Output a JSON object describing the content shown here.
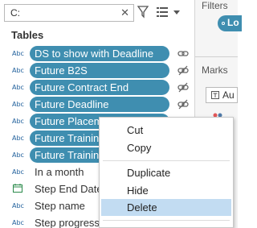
{
  "search": {
    "value": "C:",
    "clear_glyph": "✕"
  },
  "toolbar": {
    "filter_icon": "filter-icon",
    "view_icon": "list-view-icon"
  },
  "tables": {
    "heading": "Tables",
    "fields": [
      {
        "type": "Abc",
        "name": "DS to show with Deadline",
        "selected": true,
        "link_icon": "link-icon"
      },
      {
        "type": "Abc",
        "name": "Future B2S",
        "selected": true,
        "link_icon": "link-broken-icon"
      },
      {
        "type": "Abc",
        "name": "Future Contract End",
        "selected": true,
        "link_icon": "link-broken-icon"
      },
      {
        "type": "Abc",
        "name": "Future Deadline",
        "selected": true,
        "link_icon": "link-broken-icon"
      },
      {
        "type": "Abc",
        "name": "Future Placem",
        "selected": true,
        "link_icon": ""
      },
      {
        "type": "Abc",
        "name": "Future Training",
        "selected": true,
        "link_icon": ""
      },
      {
        "type": "Abc",
        "name": "Future Training",
        "selected": true,
        "link_icon": ""
      },
      {
        "type": "Abc",
        "name": "In a month",
        "selected": false,
        "link_icon": ""
      },
      {
        "type": "date",
        "name": "Step End Date",
        "selected": false,
        "link_icon": ""
      },
      {
        "type": "Abc",
        "name": "Step name",
        "selected": false,
        "link_icon": ""
      },
      {
        "type": "Abc",
        "name": "Step progress",
        "selected": false,
        "link_icon": ""
      }
    ]
  },
  "right_pane": {
    "filters_label": "Filters",
    "filter_pill_text": "Lo",
    "marks_label": "Marks",
    "marks_select_text": "Au"
  },
  "context_menu": {
    "items": [
      {
        "label": "Cut"
      },
      {
        "label": "Copy"
      },
      {
        "label": "Duplicate"
      },
      {
        "label": "Hide"
      },
      {
        "label": "Delete",
        "highlighted": true
      }
    ]
  },
  "colors": {
    "pill": "#3f8eb0",
    "highlight": "#c2dcf2",
    "type_label": "#1f5f9b"
  }
}
